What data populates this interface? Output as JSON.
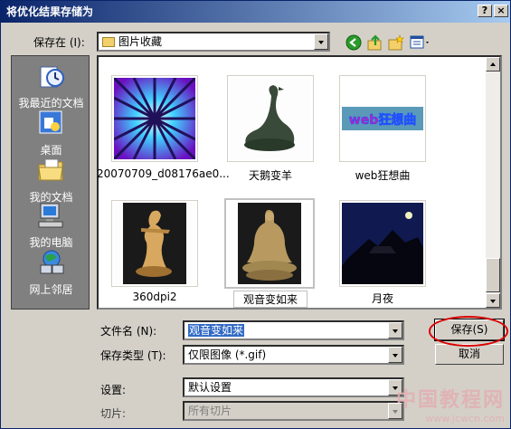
{
  "window": {
    "title": "将优化结果存储为",
    "help_button": "?",
    "close_button": "×"
  },
  "location": {
    "label": "保存在 (I):",
    "value": "图片收藏"
  },
  "places": [
    {
      "label": "我最近的文档",
      "icon": "recent-documents-icon"
    },
    {
      "label": "桌面",
      "icon": "desktop-icon"
    },
    {
      "label": "我的文档",
      "icon": "my-documents-icon"
    },
    {
      "label": "我的电脑",
      "icon": "my-computer-icon"
    },
    {
      "label": "网上邻居",
      "icon": "network-places-icon"
    }
  ],
  "files": [
    {
      "name": "20070709_d08176ae0...",
      "thumb": "sunburst-image"
    },
    {
      "name": "天鹅变羊",
      "thumb": "swan-sculpture-image"
    },
    {
      "name": "web狂想曲",
      "thumb": "web-text-image"
    },
    {
      "name": "360dpi2",
      "thumb": "dancer-figurine-image"
    },
    {
      "name": "观音变如来",
      "thumb": "guanyin-statue-image",
      "selected": true
    },
    {
      "name": "月夜",
      "thumb": "moon-night-image"
    }
  ],
  "thumb_texts": {
    "web": "web狂想曲"
  },
  "form": {
    "filename_label": "文件名 (N):",
    "filename_value": "观音变如来",
    "type_label": "保存类型 (T):",
    "type_value": "仅限图像 (*.gif)",
    "settings_label": "设置:",
    "settings_value": "默认设置",
    "slices_label": "切片:",
    "slices_value": "所有切片"
  },
  "buttons": {
    "save": "保存(S)",
    "cancel": "取消"
  },
  "watermark": {
    "line1": "中国教程网",
    "line2": "www.jcwcn.com"
  },
  "colors": {
    "titlebar": "#0a246a",
    "highlight": "#316ac5",
    "annotation_ring": "#d80000"
  }
}
